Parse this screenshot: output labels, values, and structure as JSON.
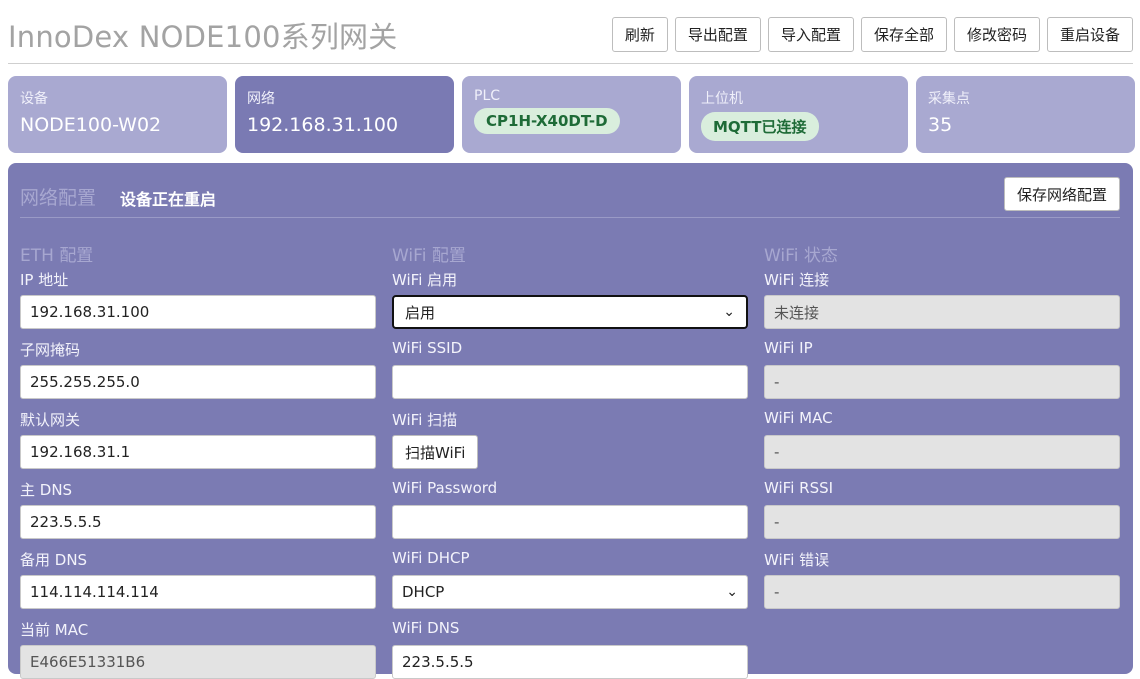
{
  "header": {
    "title": "InnoDex NODE100系列网关",
    "buttons": [
      "刷新",
      "导出配置",
      "导入配置",
      "保存全部",
      "修改密码",
      "重启设备"
    ]
  },
  "cards": [
    {
      "label": "设备",
      "value": "NODE100-W02"
    },
    {
      "label": "网络",
      "value": "192.168.31.100"
    },
    {
      "label": "PLC",
      "badge": "CP1H-X40DT-D"
    },
    {
      "label": "上位机",
      "badge": "MQTT已连接"
    },
    {
      "label": "采集点",
      "value": "35"
    }
  ],
  "panel": {
    "title": "网络配置",
    "status": "设备正在重启",
    "save_label": "保存网络配置"
  },
  "eth": {
    "title": "ETH 配置",
    "ip_label": "IP 地址",
    "ip": "192.168.31.100",
    "mask_label": "子网掩码",
    "mask": "255.255.255.0",
    "gw_label": "默认网关",
    "gw": "192.168.31.1",
    "dns1_label": "主 DNS",
    "dns1": "223.5.5.5",
    "dns2_label": "备用 DNS",
    "dns2": "114.114.114.114",
    "mac_label": "当前 MAC",
    "mac": "E466E51331B6"
  },
  "wifi": {
    "title": "WiFi 配置",
    "enable_label": "WiFi 启用",
    "enable": "启用",
    "ssid_label": "WiFi SSID",
    "ssid": "",
    "scan_label": "WiFi 扫描",
    "scan_button": "扫描WiFi",
    "password_label": "WiFi Password",
    "password": "",
    "dhcp_label": "WiFi DHCP",
    "dhcp": "DHCP",
    "dns_label": "WiFi DNS",
    "dns": "223.5.5.5"
  },
  "wifi_status": {
    "title": "WiFi 状态",
    "conn_label": "WiFi 连接",
    "conn": "未连接",
    "ip_label": "WiFi IP",
    "ip": "-",
    "mac_label": "WiFi MAC",
    "mac": "-",
    "rssi_label": "WiFi RSSI",
    "rssi": "-",
    "error_label": "WiFi 错误",
    "error": "-"
  }
}
